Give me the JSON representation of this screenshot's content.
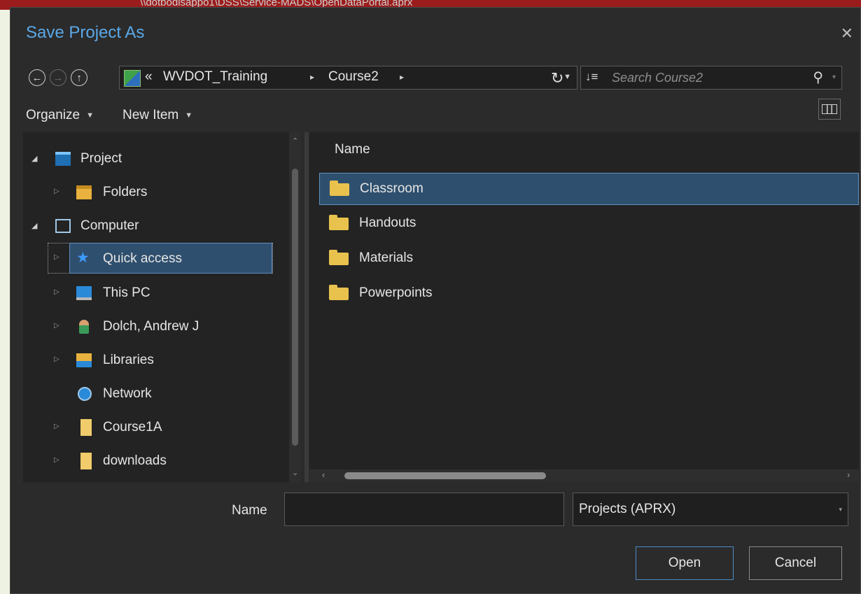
{
  "backdrop": {
    "text": "\\\\dotbodisappo1\\DSS\\Service-MADS\\OpenDataPortal.aprx"
  },
  "dialog": {
    "title": "Save Project As",
    "close_glyph": "✕"
  },
  "navigation": {
    "back_glyph": "←",
    "forward_glyph": "→",
    "up_glyph": "↑",
    "address": {
      "overflow": "«",
      "crumbs": [
        "WVDOT_Training",
        "Course2"
      ],
      "separator": "▸",
      "dropdown_glyph": "▼"
    },
    "refresh_glyph": "↻",
    "search": {
      "sort_glyph": "↓≡",
      "placeholder": "Search Course2",
      "search_glyph": "⚲",
      "dropdown_glyph": "▾"
    }
  },
  "toolbar": {
    "organize_label": "Organize",
    "new_item_label": "New Item",
    "menu_arrow": "▼",
    "view_icon": "view-pane-icon"
  },
  "tree": {
    "items": [
      {
        "label": "Project",
        "icon": "project-icon",
        "expanded": true
      },
      {
        "label": "Folders",
        "icon": "folders-icon",
        "expanded": false
      },
      {
        "label": "Computer",
        "icon": "computer-icon",
        "expanded": true
      },
      {
        "label": "Quick access",
        "icon": "star-icon",
        "expanded": false,
        "selected": true
      },
      {
        "label": "This PC",
        "icon": "monitor-icon",
        "expanded": false
      },
      {
        "label": "Dolch, Andrew J",
        "icon": "user-icon",
        "expanded": false
      },
      {
        "label": "Libraries",
        "icon": "libraries-icon",
        "expanded": false
      },
      {
        "label": "Network",
        "icon": "network-icon",
        "expanded": false
      },
      {
        "label": "Course1A",
        "icon": "folder-icon",
        "expanded": false
      },
      {
        "label": "downloads",
        "icon": "folder-icon",
        "expanded": false
      }
    ],
    "expand_glyph": "▷",
    "collapse_glyph": "◢",
    "scroll_up": "⌃",
    "scroll_down": "⌄"
  },
  "files": {
    "column_name": "Name",
    "rows": [
      {
        "label": "Classroom",
        "selected": true
      },
      {
        "label": "Handouts",
        "selected": false
      },
      {
        "label": "Materials",
        "selected": false
      },
      {
        "label": "Powerpoints",
        "selected": false
      }
    ],
    "scroll_left": "‹",
    "scroll_right": "›"
  },
  "footer": {
    "name_label": "Name",
    "name_value": "",
    "file_type": "Projects (APRX)",
    "type_caret": "▾",
    "open_label": "Open",
    "cancel_label": "Cancel"
  },
  "colors": {
    "accent": "#5aa8e8",
    "selection": "#2f4f6e",
    "folder": "#e9c24e",
    "dialog_bg": "#2b2b2b"
  }
}
